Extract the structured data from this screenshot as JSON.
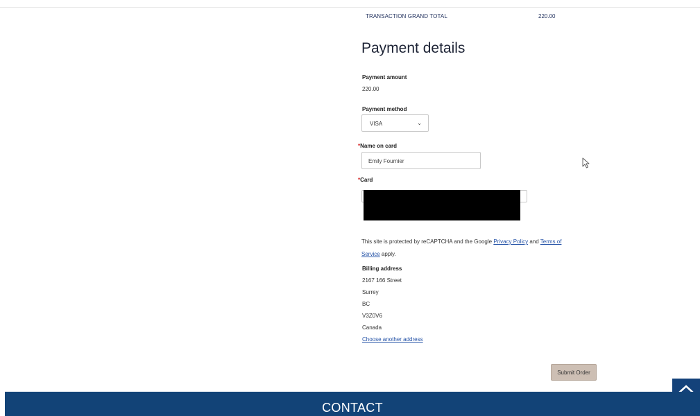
{
  "summary": {
    "grand_total_label": "TRANSACTION GRAND TOTAL",
    "grand_total_value": "220.00"
  },
  "payment": {
    "heading": "Payment details",
    "amount_label": "Payment amount",
    "amount_value": "220.00",
    "method_label": "Payment method",
    "method_selected": "VISA",
    "required_marker": "*",
    "name_label": "Name on card",
    "name_value": "Emily Fournier",
    "card_label": "Card"
  },
  "recaptcha": {
    "prefix": "This site is protected by reCAPTCHA and the Google ",
    "privacy_link": "Privacy Policy",
    "and": " and ",
    "terms_link_1": "Terms of",
    "terms_link_2": "Service",
    "suffix": " apply."
  },
  "billing": {
    "label": "Billing address",
    "street": "2167 166 Street",
    "city": "Surrey",
    "province": "BC",
    "postal": "V3Z0V6",
    "country": "Canada",
    "change_link": "Choose another address"
  },
  "actions": {
    "submit_label": "Submit Order"
  },
  "footer": {
    "contact_label": "CONTACT"
  },
  "colors": {
    "footer_bg": "#124377",
    "link": "#2553a7",
    "submit_bg": "#cdbfb4",
    "required": "#d02020"
  },
  "icons": {
    "method_dropdown": "chevron-down-icon",
    "back_to_top": "chevron-up-icon",
    "pointer": "mouse-cursor-icon"
  }
}
